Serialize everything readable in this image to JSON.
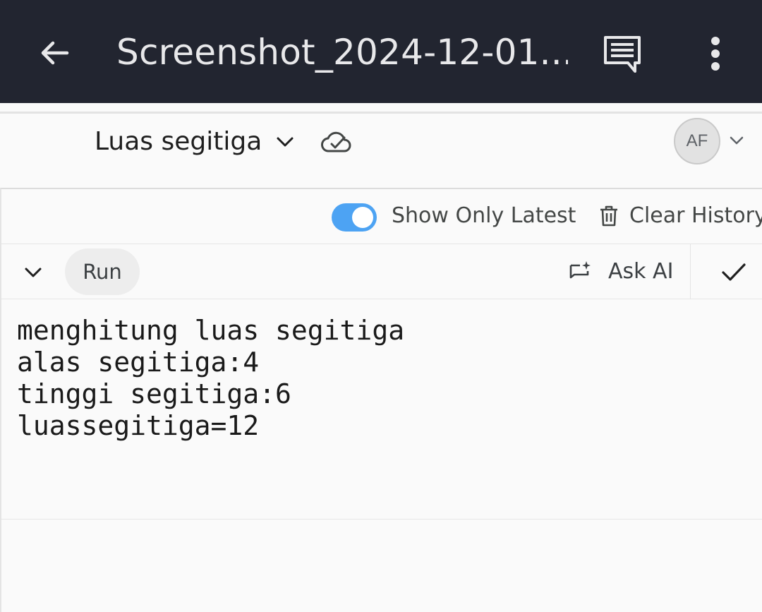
{
  "appbar": {
    "title": "Screenshot_2024-12-01...",
    "back_icon": "arrow-left-icon",
    "comment_icon": "comment-icon",
    "more_icon": "more-vert-icon"
  },
  "document": {
    "title": "Luas segitiga",
    "avatar_initials": "AF"
  },
  "history": {
    "toggle_label": "Show Only Latest",
    "toggle_on": true,
    "clear_label": "Clear History"
  },
  "cell": {
    "run_label": "Run",
    "ask_ai_label": "Ask AI",
    "output_lines": [
      "menghitung luas segitiga",
      "alas segitiga:4",
      "tinggi segitiga:6",
      "luassegitiga=12"
    ]
  },
  "colors": {
    "appbar_bg": "#222530",
    "toggle_accent": "#4da3f3",
    "page_bg": "#fafafa"
  }
}
